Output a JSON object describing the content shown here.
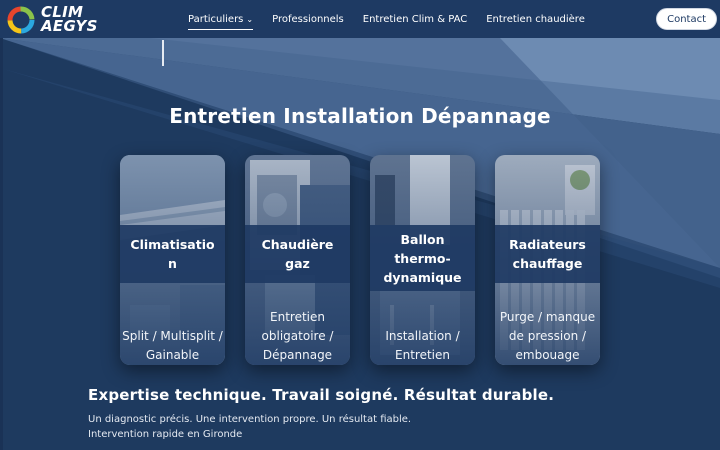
{
  "brand": {
    "line1": "CLIM",
    "line2": "AEGYS"
  },
  "nav": {
    "items": [
      {
        "label": "Particuliers",
        "has_dropdown": true,
        "active": true
      },
      {
        "label": "Professionnels"
      },
      {
        "label": "Entretien Clim & PAC"
      },
      {
        "label": "Entretien chaudière"
      }
    ],
    "chevron": "⌄",
    "contact_label": "Contact"
  },
  "hero": {
    "title": "Entretien Installation Dépannage",
    "cards": [
      {
        "title": "Climatisatio n",
        "subtitle": "Split / Multisplit / Gainable",
        "icon": "air-conditioner-photo"
      },
      {
        "title": "Chaudière gaz",
        "subtitle": "Entretien obligatoire / Dépannage",
        "icon": "boiler-photo"
      },
      {
        "title": "Ballon thermo-dynamique",
        "subtitle": "Installation / Entretien",
        "icon": "water-heater-photo"
      },
      {
        "title": "Radiateurs chauffage",
        "subtitle": "Purge / manque de pression / embouage",
        "icon": "radiator-photo"
      }
    ],
    "tagline": "Expertise technique. Travail soigné. Résultat durable.",
    "description_line1": "Un diagnostic précis. Une intervention propre. Un résultat fiable.",
    "description_line2": "Intervention rapide en Gironde"
  },
  "colors": {
    "navy": "#1e3a63",
    "hero_dark": "#1e3a5f",
    "hero_light": "#4a6a94",
    "hero_lighter": "#5b7aa3",
    "white": "#ffffff"
  }
}
